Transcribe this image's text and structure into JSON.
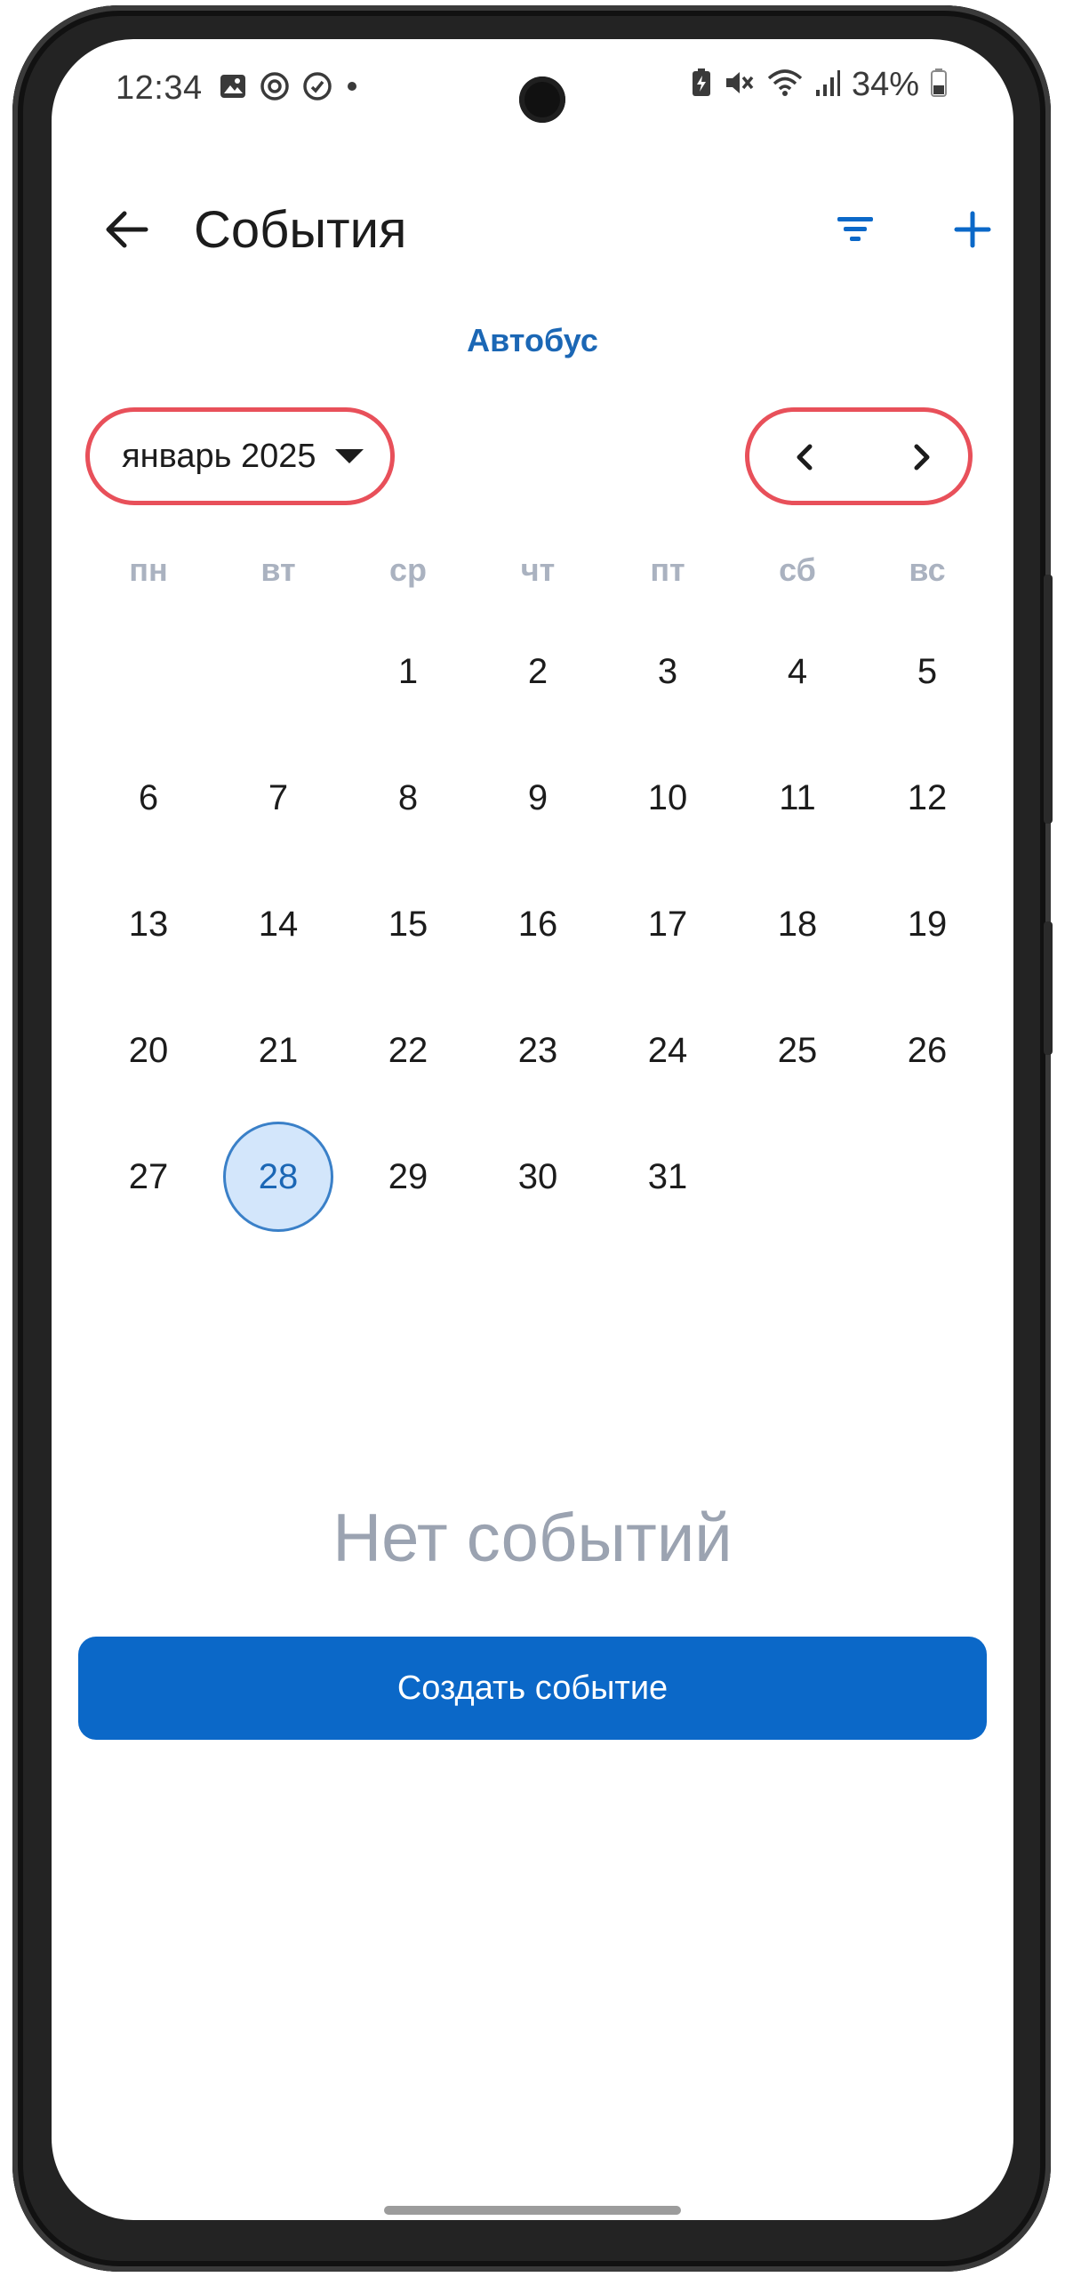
{
  "status_bar": {
    "time": "12:34",
    "battery": "34%",
    "icons_left": [
      "gallery-icon",
      "sync-icon",
      "messenger-icon",
      "dot-icon"
    ],
    "icons_right": [
      "battery-saver-icon",
      "mute-icon",
      "wifi-icon",
      "signal-icon",
      "battery-icon"
    ]
  },
  "app_bar": {
    "title": "События"
  },
  "subtitle": "Автобус",
  "calendar": {
    "month_label": "январь 2025",
    "weekdays": [
      "пн",
      "вт",
      "ср",
      "чт",
      "пт",
      "сб",
      "вс"
    ],
    "leading_blanks": 2,
    "days": [
      "1",
      "2",
      "3",
      "4",
      "5",
      "6",
      "7",
      "8",
      "9",
      "10",
      "11",
      "12",
      "13",
      "14",
      "15",
      "16",
      "17",
      "18",
      "19",
      "20",
      "21",
      "22",
      "23",
      "24",
      "25",
      "26",
      "27",
      "28",
      "29",
      "30",
      "31"
    ],
    "selected_day": "28"
  },
  "empty_state": "Нет событий",
  "create_button": "Создать событие",
  "colors": {
    "accent": "#0b68c8",
    "link": "#1b67b5",
    "highlight_outline": "#e8505a",
    "selected_fill": "#d3e6fb",
    "muted": "#9ba3b1"
  }
}
